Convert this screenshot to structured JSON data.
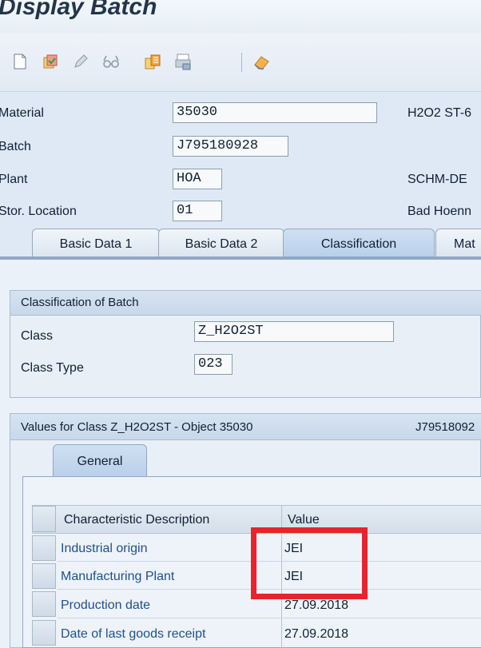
{
  "window": {
    "title": "Display Batch"
  },
  "toolbar": {
    "icons": [
      "new-document-icon",
      "change-icon",
      "pencil-icon",
      "glasses-icon",
      "copy-icon",
      "print-icon",
      "eraser-icon"
    ]
  },
  "header": {
    "material": {
      "label": "Material",
      "value": "35030",
      "description": "H2O2 ST-6"
    },
    "batch": {
      "label": "Batch",
      "value": "J795180928"
    },
    "plant": {
      "label": "Plant",
      "value": "HOA",
      "description": "SCHM-DE"
    },
    "stor_location": {
      "label": "Stor. Location",
      "value": "01",
      "description": "Bad Hoenn"
    }
  },
  "tabs": [
    {
      "label": "Basic Data 1",
      "active": false
    },
    {
      "label": "Basic Data 2",
      "active": false
    },
    {
      "label": "Classification",
      "active": true
    },
    {
      "label": "Mat",
      "active": false
    }
  ],
  "classification": {
    "title": "Classification of Batch",
    "class_label": "Class",
    "class_value": "Z_H2O2ST",
    "class_type_label": "Class Type",
    "class_type_value": "023"
  },
  "values": {
    "title": "Values for Class Z_H2O2ST - Object 35030",
    "object_right": "J79518092",
    "inner_tab": "General",
    "columns": [
      "Characteristic Description",
      "Value"
    ],
    "rows": [
      {
        "description": "Industrial origin",
        "value": "JEI"
      },
      {
        "description": "Manufacturing Plant",
        "value": "JEI"
      },
      {
        "description": "Production date",
        "value": "27.09.2018"
      },
      {
        "description": "Date of last goods receipt",
        "value": "27.09.2018"
      }
    ]
  },
  "colors": {
    "highlight": "#e8232b",
    "link": "#1f4f8f",
    "active_tab": "#b9d0ea"
  }
}
